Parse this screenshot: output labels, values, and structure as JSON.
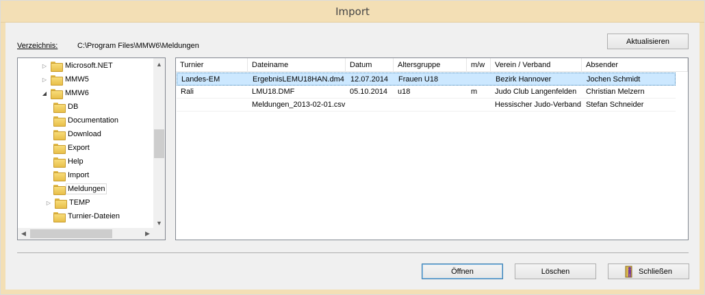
{
  "window": {
    "title": "Import"
  },
  "directory": {
    "label": "Verzeichnis:",
    "path": "C:\\Program Files\\MMW6\\Meldungen"
  },
  "buttons": {
    "refresh": "Aktualisieren",
    "open": "Öffnen",
    "delete": "Löschen",
    "close": "Schließen"
  },
  "tree": {
    "items": [
      {
        "label": "Microsoft.NET",
        "arrow": "▷"
      },
      {
        "label": "MMW5",
        "arrow": "▷"
      },
      {
        "label": "MMW6",
        "arrow": "◢"
      },
      {
        "label": "DB",
        "arrow": ""
      },
      {
        "label": "Documentation",
        "arrow": ""
      },
      {
        "label": "Download",
        "arrow": ""
      },
      {
        "label": "Export",
        "arrow": ""
      },
      {
        "label": "Help",
        "arrow": ""
      },
      {
        "label": "Import",
        "arrow": ""
      },
      {
        "label": "Meldungen",
        "arrow": ""
      },
      {
        "label": "TEMP",
        "arrow": "▷"
      },
      {
        "label": "Turnier-Dateien",
        "arrow": ""
      }
    ]
  },
  "table": {
    "columns": [
      "Turnier",
      "Dateiname",
      "Datum",
      "Altersgruppe",
      "m/w",
      "Verein / Verband",
      "Absender"
    ],
    "rows": [
      [
        "Landes-EM",
        "ErgebnisLEMU18HAN.dm4",
        "12.07.2014",
        "Frauen U18",
        "",
        "Bezirk Hannover",
        "Jochen Schmidt"
      ],
      [
        "Rali",
        "LMU18.DMF",
        "05.10.2014",
        "u18",
        "m",
        "Judo Club Langenfelden",
        "Christian Melzern"
      ],
      [
        "",
        "Meldungen_2013-02-01.csv",
        "",
        "",
        "",
        "Hessischer Judo-Verband",
        "Stefan Schneider"
      ]
    ]
  },
  "colors": {
    "titlebar": "#f3dfb5",
    "selection": "#cce8ff",
    "folder": "#f8dc7a"
  }
}
